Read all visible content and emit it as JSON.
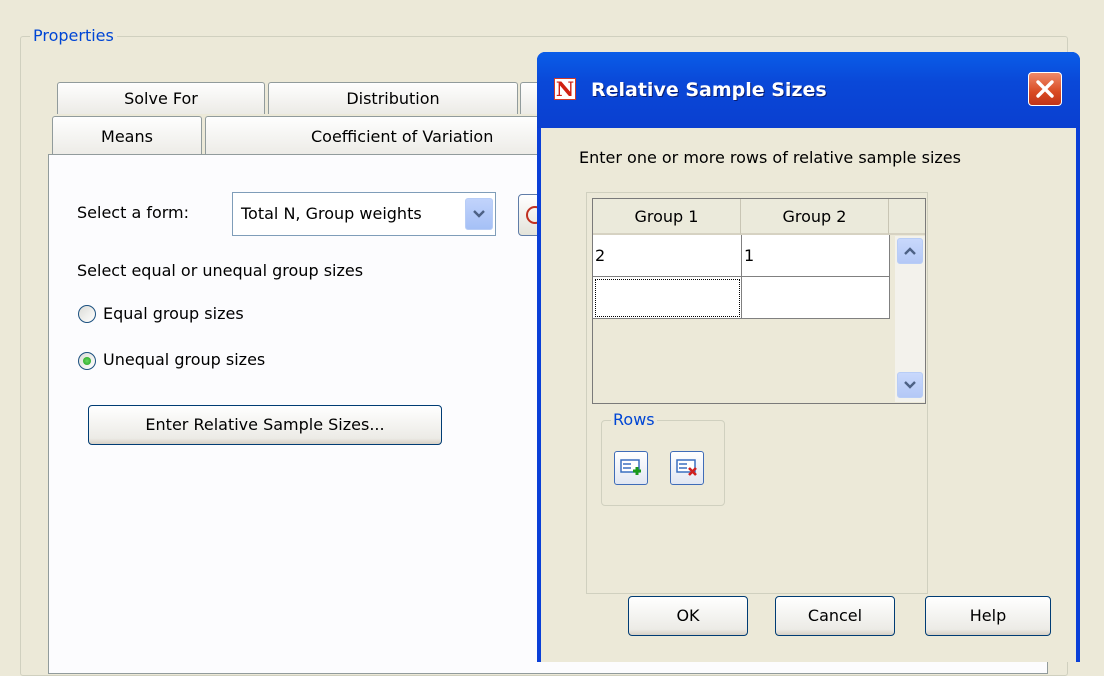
{
  "properties": {
    "title": "Properties",
    "tabs_row1": [
      "Solve For",
      "Distribution",
      ""
    ],
    "tabs_row2": [
      "Means",
      "Coefficient of Variation"
    ],
    "form_label": "Select a form:",
    "form_value": "Total N, Group weights",
    "group_sizes_label": "Select equal or unequal group sizes",
    "radio_equal": "Equal group sizes",
    "radio_unequal": "Unequal group sizes",
    "selected_radio": "Unequal group sizes",
    "enter_button": "Enter Relative Sample Sizes..."
  },
  "dialog": {
    "title": "Relative Sample Sizes",
    "app_icon_letter": "N",
    "instruction": "Enter one or more rows of relative sample sizes",
    "columns": [
      "Group 1",
      "Group 2"
    ],
    "rows": [
      [
        "2",
        "1"
      ],
      [
        "",
        ""
      ]
    ],
    "rows_group_label": "Rows",
    "ok_label": "OK",
    "cancel_label": "Cancel",
    "help_label": "Help"
  },
  "icons": {
    "close": "close-icon",
    "add_row": "add-row-icon",
    "delete_row": "delete-row-icon",
    "scroll_up": "scroll-up-icon",
    "scroll_down": "scroll-down-icon",
    "dropdown": "chevron-down-icon"
  },
  "colors": {
    "accent": "#0046d5",
    "titlebar": "#0a48d8",
    "close_button": "#d84a22",
    "background": "#ece9d8"
  }
}
